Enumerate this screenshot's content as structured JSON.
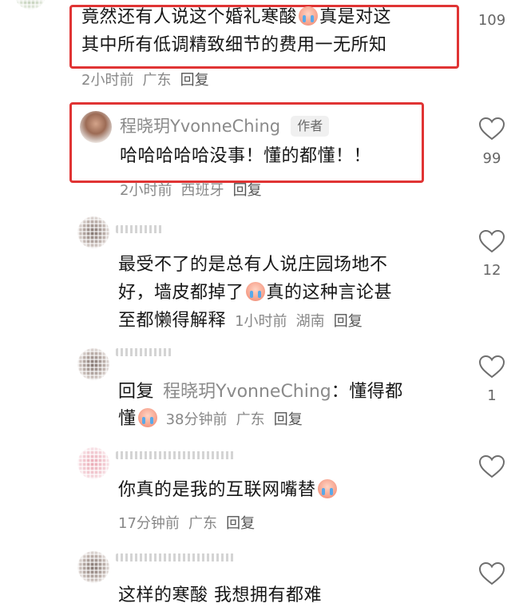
{
  "comments": [
    {
      "text_line1": "竟然还有人说这个婚礼寒酸",
      "text_line1b": "真是对这",
      "text_line2": "其中所有低调精致细节的费用一无所知",
      "time": "2小时前",
      "location": "广东",
      "reply": "回复",
      "likes": "109",
      "emoji": "crying-face-icon"
    },
    {
      "author": "程晓玥YvonneChing",
      "author_tag": "作者",
      "text": "哈哈哈哈哈没事！懂的都懂！！",
      "time": "2小时前",
      "location": "西班牙",
      "reply": "回复",
      "likes": "99"
    },
    {
      "text_line1": "最受不了的是总有人说庄园场地不",
      "text_line2a": "好，墙皮都掉了",
      "text_line2b": "真的这种言论甚",
      "text_line3": "至都懒得解释",
      "time": "1小时前",
      "location": "湖南",
      "reply": "回复",
      "likes": "12",
      "emoji": "crying-face-icon"
    },
    {
      "prefix": "回复",
      "reply_to": "程晓玥YvonneChing",
      "text_line1": "：懂得都",
      "text_line2": "懂",
      "time": "38分钟前",
      "location": "广东",
      "reply": "回复",
      "likes": "1",
      "emoji": "crying-face-icon"
    },
    {
      "text": "你真的是我的互联网嘴替",
      "time": "17分钟前",
      "location": "广东",
      "reply": "回复",
      "emoji": "crying-face-icon"
    },
    {
      "text": "这样的寒酸 我想拥有都难"
    }
  ],
  "colors": {
    "highlight_border": "#e03434",
    "meta_text": "#888888",
    "body_text": "#161616"
  }
}
